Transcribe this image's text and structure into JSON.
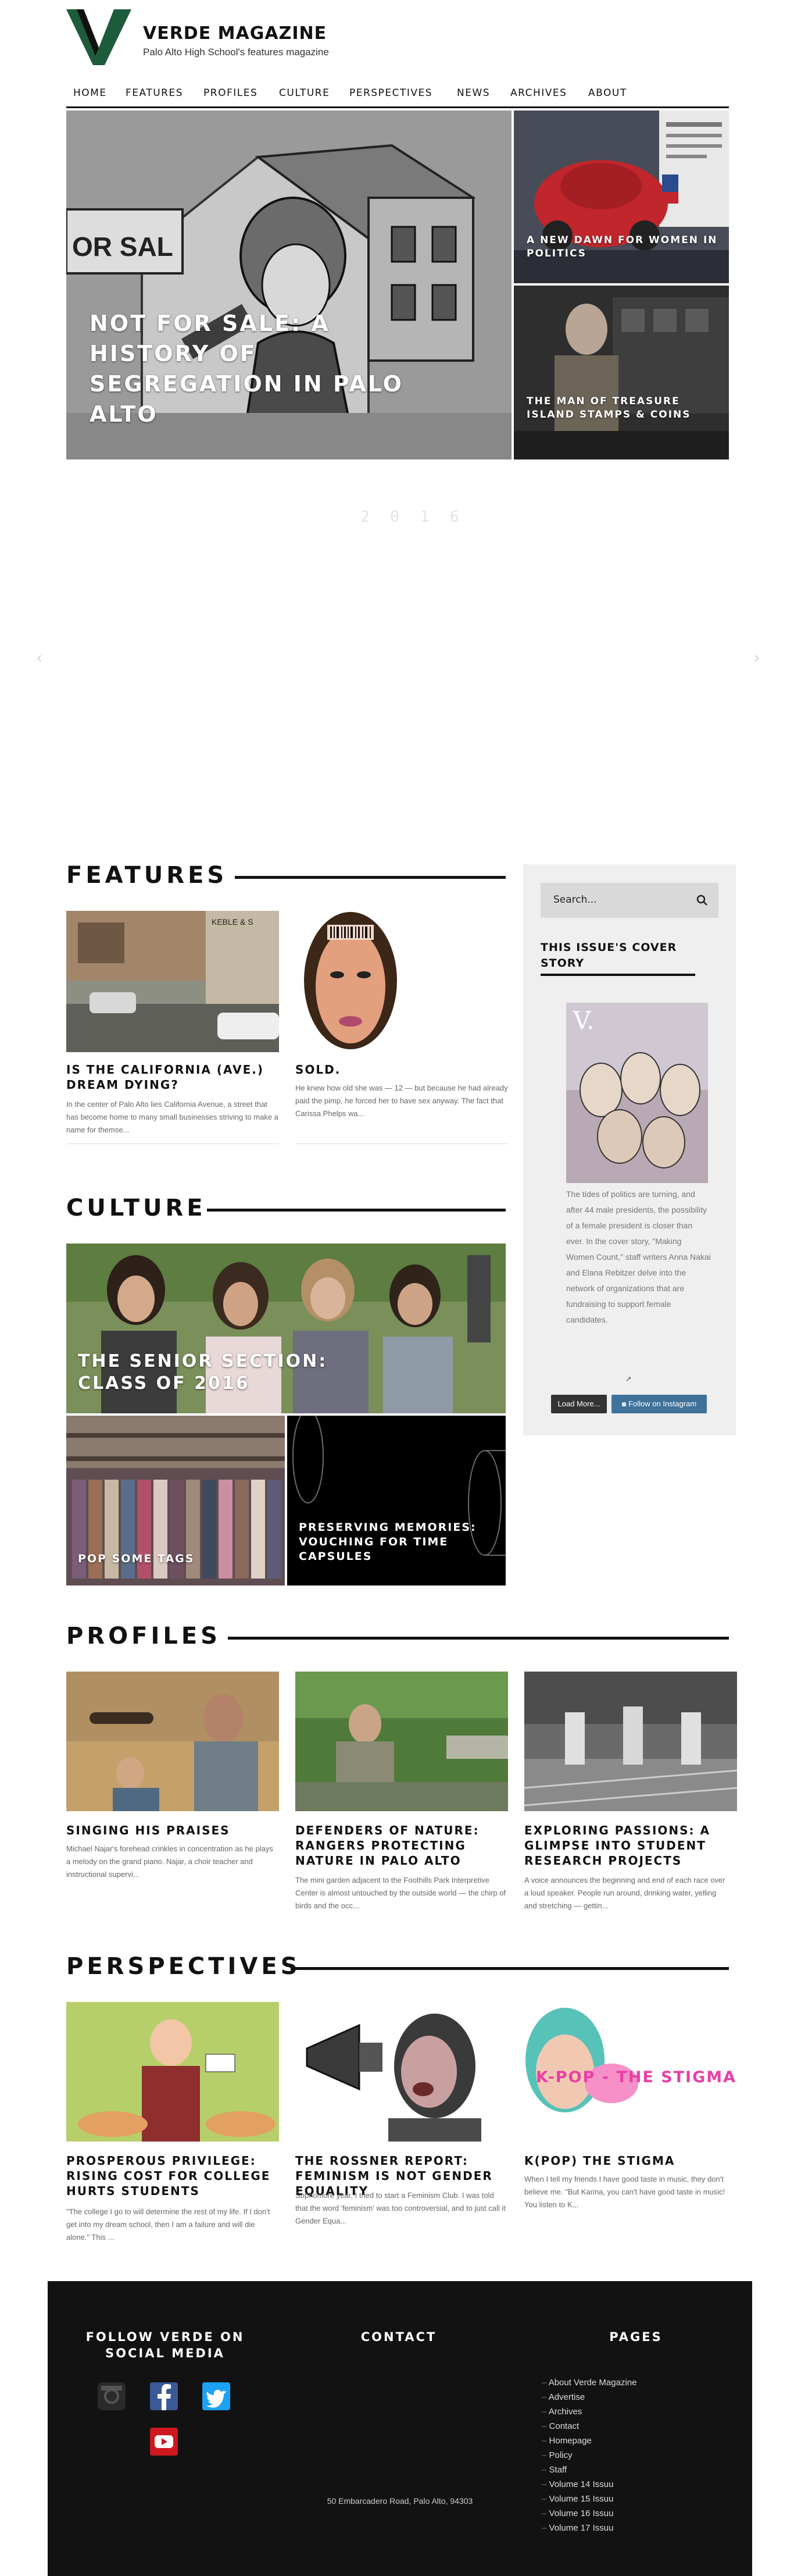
{
  "site": {
    "title": "VERDE MAGAZINE",
    "tagline": "Palo Alto High School's features magazine"
  },
  "nav": [
    "HOME",
    "FEATURES",
    "PROFILES",
    "CULTURE",
    "PERSPECTIVES",
    "NEWS",
    "ARCHIVES",
    "ABOUT"
  ],
  "hero": {
    "main_title": "NOT FOR SALE: A HISTORY OF SEGREGATION IN PALO ALTO",
    "side1_title": "A NEW DAWN FOR WOMEN IN POLITICS",
    "side2_title": "THE MAN OF TREASURE ISLAND STAMPS & COINS",
    "ghost_text": "2 0 1 6",
    "arrow_prev": "‹",
    "arrow_next": "›"
  },
  "features": {
    "heading": "FEATURES",
    "items": [
      {
        "title": "IS THE CALIFORNIA (AVE.) DREAM DYING?",
        "excerpt": "In the center of Palo Alto lies California Avenue, a street that has become home to many small businesses striving to make a name for themse..."
      },
      {
        "title": "SOLD.",
        "excerpt": "He knew how old she was — 12 — but because he had already paid the pimp, he forced her to have sex anyway. The fact that Carissa Phelps wa..."
      }
    ]
  },
  "culture": {
    "heading": "CULTURE",
    "main_title": "THE SENIOR SECTION: CLASS OF 2016",
    "item2_title": "POP SOME TAGS",
    "item3_title": "PRESERVING MEMORIES: VOUCHING FOR TIME CAPSULES"
  },
  "profiles": {
    "heading": "PROFILES",
    "items": [
      {
        "title": "SINGING HIS PRAISES",
        "excerpt": "Michael Najar's forehead crinkles in concentration as he plays a melody on the grand piano. Najar, a choir teacher and instructional supervi..."
      },
      {
        "title": "DEFENDERS OF NATURE: RANGERS PROTECTING NATURE IN PALO ALTO",
        "excerpt": "The mini garden adjacent to the Foothills Park Interpretive Center is almost untouched by the outside world — the chirp of birds and the occ..."
      },
      {
        "title": "EXPLORING PASSIONS: A GLIMPSE INTO STUDENT RESEARCH PROJECTS",
        "excerpt": "A voice announces the beginning and end of each race over a loud speaker. People run around, drinking water, yelling and stretching — gettin..."
      }
    ]
  },
  "perspectives": {
    "heading": "PERSPECTIVES",
    "items": [
      {
        "title": "PROSPEROUS PRIVILEGE: RISING COST FOR COLLEGE HURTS STUDENTS",
        "excerpt": "\"The college I go to will determine the rest of my life. If I don't get into my dream school, then I am a failure and will die alone.\" This ..."
      },
      {
        "title": "THE ROSSNER REPORT: FEMINISM IS NOT GENDER EQUALITY",
        "excerpt": "Sophomore year, I tried to start a Feminism Club. I was told that the word 'feminism' was too controversial, and to just call it Gender Equa..."
      },
      {
        "title": "K(POP) THE STIGMA",
        "excerpt": "When I tell my friends I have good taste in music, they don't believe me. \"But Karina, you can't have good taste in music! You listen to K..."
      }
    ],
    "kpop_art_text": "K-POP - THE STIGMA"
  },
  "sidebar": {
    "search_placeholder": "Search...",
    "cover_heading": "THIS ISSUE'S COVER STORY",
    "cover_letter": "V.",
    "cover_desc": "The tides of politics are turning, and after 44 male presidents, the possibility of a female president is closer than ever. In the cover story, \"Making Women Count,\" staff writers Anna Nakai and Elana Rebitzer delve into the network of organizations that are fundraising to support female candidates.",
    "load_more": "Load More...",
    "instagram": "Follow on Instagram"
  },
  "footer": {
    "social_heading": "FOLLOW VERDE ON SOCIAL MEDIA",
    "contact_heading": "CONTACT",
    "pages_heading": "PAGES",
    "address": "50 Embarcadero Road, Palo Alto, 94303",
    "pages": [
      "About Verde Magazine",
      "Advertise",
      "Archives",
      "Contact",
      "Homepage",
      "Policy",
      "Staff",
      "Volume 14 Issuu",
      "Volume 15 Issuu",
      "Volume 16 Issuu",
      "Volume 17 Issuu"
    ]
  },
  "colors": {
    "brand_green": "#1e5b3a",
    "instagram_blue": "#3f729b",
    "facebook_blue": "#3b5998",
    "twitter_blue": "#1da1f2",
    "youtube_red": "#cc181e",
    "footer_bg": "#121212"
  }
}
